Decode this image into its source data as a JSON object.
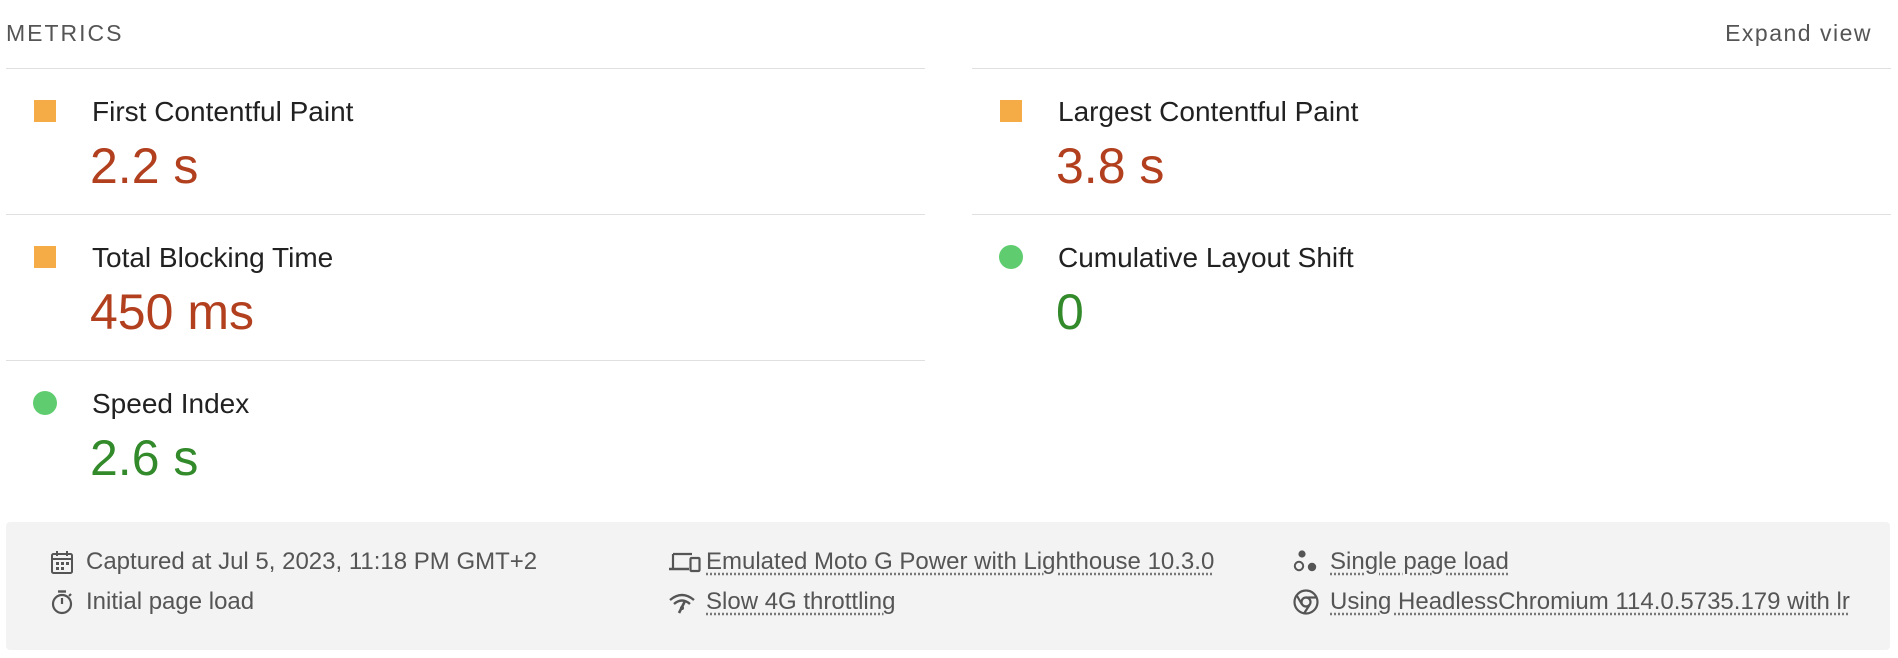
{
  "header": {
    "title": "METRICS",
    "expand_label": "Expand view"
  },
  "metrics": {
    "fcp": {
      "name": "First Contentful Paint",
      "value": "2.2 s",
      "status_icon": "orange-square-icon"
    },
    "lcp": {
      "name": "Largest Contentful Paint",
      "value": "3.8 s",
      "status_icon": "orange-square-icon"
    },
    "tbt": {
      "name": "Total Blocking Time",
      "value": "450 ms",
      "status_icon": "orange-square-icon"
    },
    "cls": {
      "name": "Cumulative Layout Shift",
      "value": "0",
      "status_icon": "green-circle-icon"
    },
    "si": {
      "name": "Speed Index",
      "value": "2.6 s",
      "status_icon": "green-circle-icon"
    }
  },
  "footer": {
    "captured": "Captured at Jul 5, 2023, 11:18 PM GMT+2",
    "initial_load": "Initial page load",
    "emulated": "Emulated Moto G Power with Lighthouse 10.3.0",
    "throttling": "Slow 4G throttling",
    "single_load": "Single page load",
    "browser": "Using HeadlessChromium 114.0.5735.179 with lr"
  },
  "colors": {
    "average": "#f5ac46",
    "good": "#5fcd6f",
    "average_text": "#b2401f",
    "good_text": "#328a2a"
  }
}
